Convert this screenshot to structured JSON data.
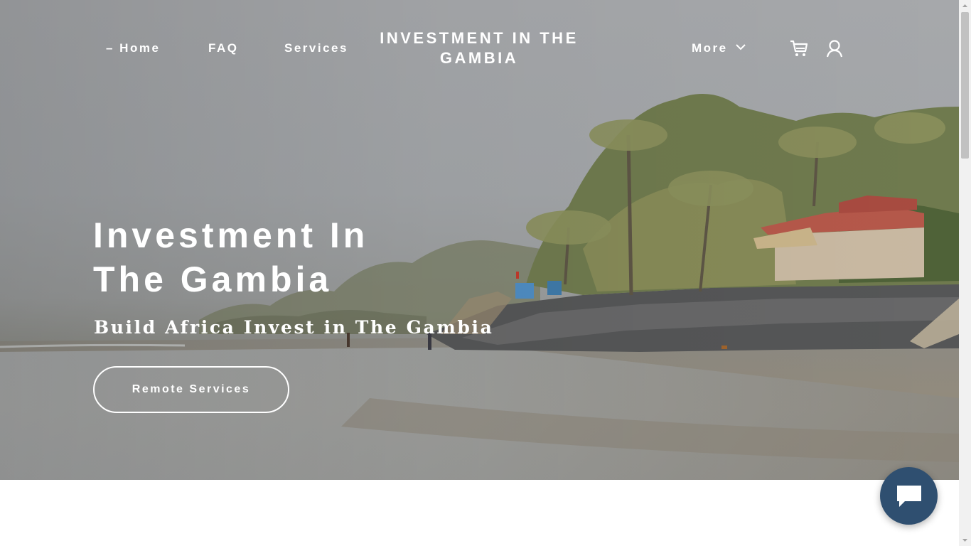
{
  "nav": {
    "home_label": "– Home",
    "faq_label": "FAQ",
    "services_label": "Services",
    "brand": "INVESTMENT IN THE GAMBIA",
    "more_label": "More",
    "cart_icon": "cart-icon",
    "account_icon": "account-icon",
    "more_icon": "chevron-down-icon"
  },
  "hero": {
    "title": "Investment In The Gambia",
    "tagline": "Build Africa Invest in The Gambia",
    "cta_label": "Remote Services"
  },
  "chat": {
    "icon": "chat-icon"
  },
  "colors": {
    "chat_button": "#2f4f70",
    "hero_sky": "#a6a8ab",
    "text": "#ffffff"
  }
}
